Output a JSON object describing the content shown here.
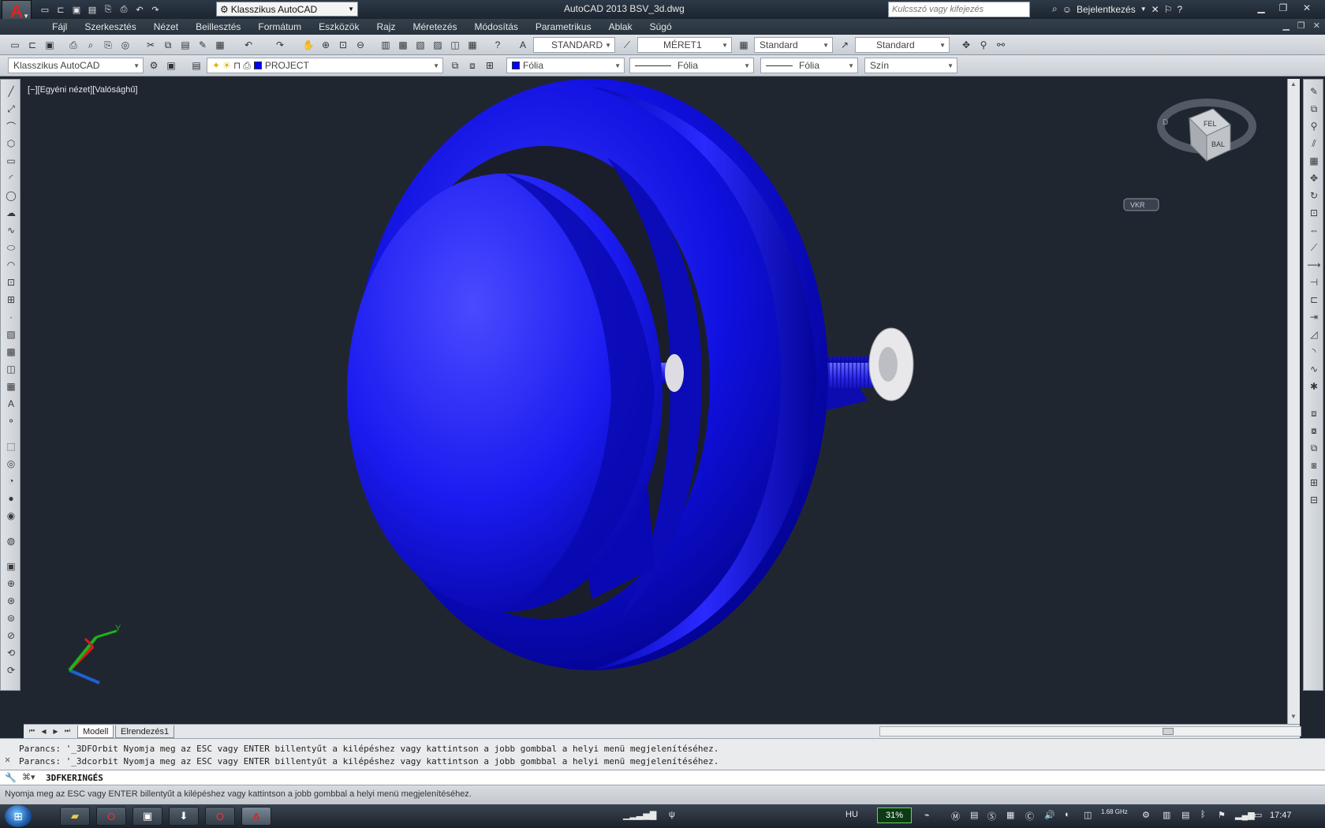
{
  "titlebar": {
    "app_title": "AutoCAD 2013    BSV_3d.dwg",
    "workspace": "Klasszikus AutoCAD",
    "search_placeholder": "Kulcsszó vagy kifejezés",
    "login": "Bejelentkezés"
  },
  "menu": {
    "items": [
      "Fájl",
      "Szerkesztés",
      "Nézet",
      "Beillesztés",
      "Formátum",
      "Eszközök",
      "Rajz",
      "Méretezés",
      "Módosítás",
      "Parametrikus",
      "Ablak",
      "Súgó"
    ]
  },
  "toolbar1": {
    "text_style": "STANDARD",
    "dim_style": "MÉRET1",
    "table_style": "Standard",
    "multileader_style": "Standard"
  },
  "toolbar2": {
    "workspace": "Klasszikus AutoCAD",
    "layer": "PROJECT",
    "color": "Fólia",
    "linetype": "Fólia",
    "lineweight": "Fólia",
    "plotstyle": "Szín"
  },
  "viewport": {
    "label": "[−][Egyéni nézet][Valósághű]",
    "wcs_label": "VKR",
    "viewcube_face_top": "FEL",
    "viewcube_face_side": "BAL",
    "compass_letter": "D"
  },
  "tabs": {
    "model": "Modell",
    "layout1": "Elrendezés1"
  },
  "command": {
    "history_1": "Parancs: '_3DFOrbit Nyomja meg az ESC vagy ENTER billentyűt a kilépéshez vagy kattintson a jobb gombbal a helyi menü megjelenítéséhez.",
    "history_2": "Parancs: '_3dcorbit Nyomja meg az ESC vagy ENTER billentyűt a kilépéshez vagy kattintson a jobb gombbal a helyi menü megjelenítéséhez.",
    "current": "3DFKERINGÉS"
  },
  "status": {
    "text": "Nyomja meg az ESC vagy ENTER billentyűt a kilépéshez vagy kattintson a jobb gombbal a helyi menü megjelenítéséhez."
  },
  "taskbar": {
    "language": "HU",
    "battery": "31%",
    "cpu_freq": "1.68 GHz",
    "clock": "17:47"
  },
  "colors": {
    "model_blue": "#0000ff",
    "viewport_bg": "#202630"
  }
}
